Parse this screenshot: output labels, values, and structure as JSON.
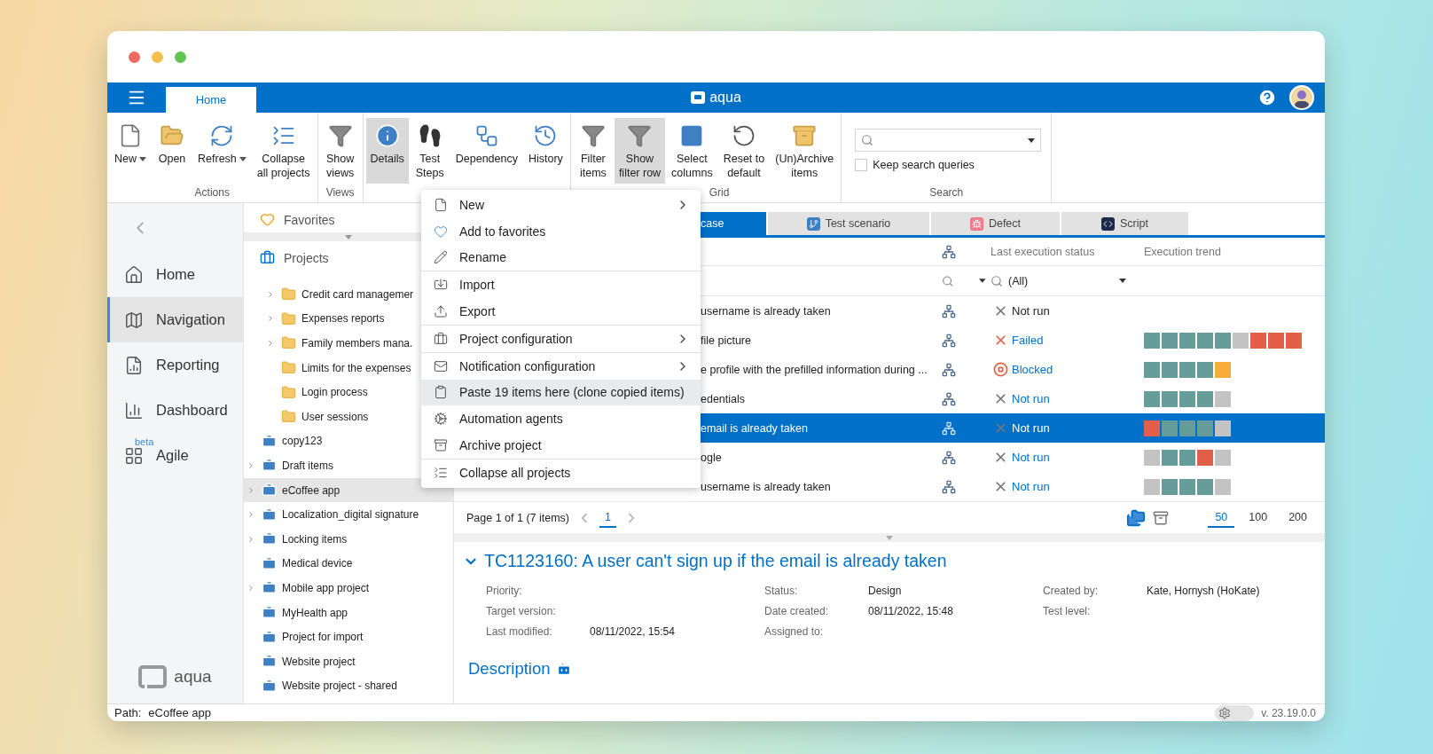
{
  "top_bar": {
    "tabs": [
      {
        "label": "Home",
        "selected": true
      }
    ],
    "app_name": "aqua"
  },
  "ribbon": {
    "groups": [
      {
        "label": "Actions",
        "buttons": [
          {
            "kind": "new",
            "lines": [
              "New"
            ],
            "dropdown": true,
            "selected": false
          },
          {
            "kind": "open",
            "lines": [
              "Open"
            ],
            "dropdown": false,
            "selected": false
          },
          {
            "kind": "refresh",
            "lines": [
              "Refresh"
            ],
            "dropdown": true,
            "selected": false
          },
          {
            "kind": "collapse",
            "lines": [
              "Collapse",
              "all projects"
            ],
            "dropdown": false,
            "selected": false
          }
        ]
      },
      {
        "label": "Views",
        "buttons": [
          {
            "kind": "views",
            "lines": [
              "Show",
              "views"
            ],
            "dropdown": false,
            "selected": false
          }
        ]
      },
      {
        "buttons": [
          {
            "kind": "details",
            "lines": [
              "Details"
            ],
            "dropdown": false,
            "selected": true
          },
          {
            "kind": "steps",
            "lines": [
              "Test",
              "Steps"
            ],
            "dropdown": false,
            "selected": false
          },
          {
            "kind": "dependency",
            "lines": [
              "Dependency"
            ],
            "dropdown": false,
            "selected": false
          },
          {
            "kind": "history",
            "lines": [
              "History"
            ],
            "dropdown": false,
            "selected": false
          }
        ]
      },
      {
        "label": "Grid",
        "buttons": [
          {
            "kind": "filter",
            "lines": [
              "Filter",
              "items"
            ],
            "dropdown": false,
            "selected": false
          },
          {
            "kind": "filter_row",
            "lines": [
              "Show",
              "filter row"
            ],
            "dropdown": false,
            "selected": true
          },
          {
            "kind": "columns",
            "lines": [
              "Select",
              "columns"
            ],
            "dropdown": false,
            "selected": false
          },
          {
            "kind": "reset",
            "lines": [
              "Reset to",
              "default"
            ],
            "dropdown": false,
            "selected": false
          },
          {
            "kind": "archive",
            "lines": [
              "(Un)Archive",
              "items"
            ],
            "dropdown": false,
            "selected": false
          }
        ]
      },
      {
        "label": "Search",
        "search": {
          "keep": {
            "label": "Keep search queries",
            "checked": false
          }
        }
      }
    ]
  },
  "nav": {
    "items": [
      {
        "kind": "home",
        "label": "Home",
        "selected": false
      },
      {
        "kind": "navigation",
        "label": "Navigation",
        "selected": true
      },
      {
        "kind": "reporting",
        "label": "Reporting",
        "selected": false
      },
      {
        "kind": "dashboard",
        "label": "Dashboard",
        "selected": false
      },
      {
        "kind": "agile",
        "label": "Agile",
        "badge": "beta",
        "selected": false
      }
    ],
    "logo": "aqua"
  },
  "tree": {
    "favorites": "Favorites",
    "projects_header": "Projects",
    "scrolled_folders": [
      {
        "label": "Credit card managemer",
        "expandable": true
      },
      {
        "label": "Expenses reports",
        "expandable": true
      },
      {
        "label": "Family members mana.",
        "expandable": true
      },
      {
        "label": "Limits for the expenses",
        "expandable": false
      },
      {
        "label": "Login process",
        "expandable": false
      },
      {
        "label": "User sessions",
        "expandable": false
      }
    ],
    "projects": [
      {
        "label": "copy123",
        "expandable": false,
        "selected": false
      },
      {
        "label": "Draft items",
        "expandable": true,
        "selected": false
      },
      {
        "label": "eCoffee app",
        "expandable": true,
        "selected": true
      },
      {
        "label": "Localization_digital signature",
        "expandable": true,
        "selected": false
      },
      {
        "label": "Locking items",
        "expandable": true,
        "selected": false
      },
      {
        "label": "Medical device",
        "expandable": false,
        "selected": false
      },
      {
        "label": "Mobile app project",
        "expandable": true,
        "selected": false
      },
      {
        "label": "MyHealth app",
        "expandable": false,
        "selected": false
      },
      {
        "label": "Project for import",
        "expandable": false,
        "selected": false
      },
      {
        "label": "Website project",
        "expandable": false,
        "selected": false
      },
      {
        "label": "Website project - shared",
        "expandable": false,
        "selected": false
      }
    ]
  },
  "context_menu": {
    "groups": [
      [
        {
          "kind": "new",
          "label": "New",
          "submenu": true,
          "highlighted": false
        },
        {
          "kind": "favorite",
          "label": "Add to favorites",
          "submenu": false,
          "highlighted": false
        },
        {
          "kind": "rename",
          "label": "Rename",
          "submenu": false,
          "highlighted": false
        }
      ],
      [
        {
          "kind": "import",
          "label": "Import",
          "submenu": false,
          "highlighted": false
        },
        {
          "kind": "export",
          "label": "Export",
          "submenu": false,
          "highlighted": false
        }
      ],
      [
        {
          "kind": "project_config",
          "label": "Project configuration",
          "submenu": true,
          "highlighted": false
        }
      ],
      [
        {
          "kind": "notification",
          "label": "Notification configuration",
          "submenu": true,
          "highlighted": false
        },
        {
          "kind": "paste",
          "label": "Paste 19 items here (clone copied items)",
          "submenu": false,
          "highlighted": true
        },
        {
          "kind": "agents",
          "label": "Automation agents",
          "submenu": false,
          "highlighted": false
        },
        {
          "kind": "archive",
          "label": "Archive project",
          "submenu": false,
          "highlighted": false
        }
      ],
      [
        {
          "kind": "collapse",
          "label": "Collapse all projects",
          "submenu": false,
          "highlighted": false
        }
      ]
    ]
  },
  "grid": {
    "tabs": [
      {
        "kind": "test_case",
        "label": "case",
        "selected": true
      },
      {
        "kind": "scenario",
        "label": "Test scenario",
        "selected": false
      },
      {
        "kind": "defect",
        "label": "Defect",
        "selected": false
      },
      {
        "kind": "script",
        "label": "Script",
        "selected": false
      }
    ],
    "columns": {
      "status": "Last execution status",
      "trend": "Execution trend"
    },
    "status_filter": "(All)",
    "rows": [
      {
        "name": "username is already taken",
        "status": {
          "kind": "not_run",
          "text": "Not run",
          "linked": false
        },
        "selected": false
      },
      {
        "name": "file picture",
        "status": {
          "kind": "failed",
          "text": "Failed",
          "linked": true
        },
        "selected": false,
        "trend": [
          {
            "color": "#669d9b"
          },
          {
            "color": "#669d9b"
          },
          {
            "color": "#669d9b"
          },
          {
            "color": "#669d9b"
          },
          {
            "color": "#669d9b"
          },
          {
            "color": "#c3c3c3"
          },
          {
            "color": "#e25f49"
          },
          {
            "color": "#e25f49"
          },
          {
            "color": "#e25f49"
          }
        ]
      },
      {
        "name": "e profile with the prefilled information during ...",
        "status": {
          "kind": "blocked",
          "text": "Blocked",
          "linked": true
        },
        "selected": false,
        "trend": [
          {
            "color": "#669d9b"
          },
          {
            "color": "#669d9b"
          },
          {
            "color": "#669d9b"
          },
          {
            "color": "#669d9b"
          },
          {
            "color": "#f7ab3b"
          }
        ]
      },
      {
        "name": "edentials",
        "status": {
          "kind": "not_run",
          "text": "Not run",
          "linked": true
        },
        "selected": false,
        "trend": [
          {
            "color": "#669d9b"
          },
          {
            "color": "#669d9b"
          },
          {
            "color": "#669d9b"
          },
          {
            "color": "#669d9b"
          },
          {
            "color": "#c3c3c3"
          }
        ]
      },
      {
        "name": "email is already taken",
        "status": {
          "kind": "not_run",
          "text": "Not run"
        },
        "selected": true,
        "trend": [
          {
            "color": "#e25f49"
          },
          {
            "color": "#669d9b"
          },
          {
            "color": "#669d9b"
          },
          {
            "color": "#669d9b"
          },
          {
            "color": "#c3c3c3"
          }
        ]
      },
      {
        "name": "ogle",
        "status": {
          "kind": "not_run",
          "text": "Not run",
          "linked": true
        },
        "selected": false,
        "trend": [
          {
            "color": "#c3c3c3"
          },
          {
            "color": "#669d9b"
          },
          {
            "color": "#669d9b"
          },
          {
            "color": "#e25f49"
          },
          {
            "color": "#c3c3c3"
          }
        ]
      },
      {
        "name": "username is already taken",
        "status": {
          "kind": "not_run",
          "text": "Not run",
          "linked": true
        },
        "selected": false,
        "trend": [
          {
            "color": "#c3c3c3"
          },
          {
            "color": "#669d9b"
          },
          {
            "color": "#669d9b"
          },
          {
            "color": "#669d9b"
          },
          {
            "color": "#c3c3c3"
          }
        ]
      }
    ],
    "pager": {
      "summary": "Page 1 of 1 (7 items)",
      "pages": [
        {
          "label": "1",
          "selected": true
        }
      ],
      "sizes": [
        {
          "label": "50",
          "selected": true
        },
        {
          "label": "100",
          "selected": false
        },
        {
          "label": "200",
          "selected": false
        }
      ]
    }
  },
  "details": {
    "title": "TC1123160: A user can't sign up if the email is already taken",
    "expanded": true,
    "columns": [
      [
        {
          "label": "Priority:"
        },
        {
          "label": "Target version:"
        },
        {
          "label": "Last modified:",
          "value": "08/11/2022, 15:54"
        }
      ],
      [
        {
          "label": "Status:",
          "value": "Design"
        },
        {
          "label": "Date created:",
          "value": "08/11/2022, 15:48"
        },
        {
          "label": "Assigned to:"
        }
      ],
      [
        {
          "label": "Created by:",
          "value": "Kate, Hornysh (HoKate)"
        },
        {
          "label": "Test level:"
        }
      ]
    ],
    "description": "Description"
  },
  "status_bar": {
    "path_label": "Path:",
    "path": "eCoffee app",
    "settings_toggle": {
      "on": false
    },
    "version": "v. 23.19.0.0"
  }
}
